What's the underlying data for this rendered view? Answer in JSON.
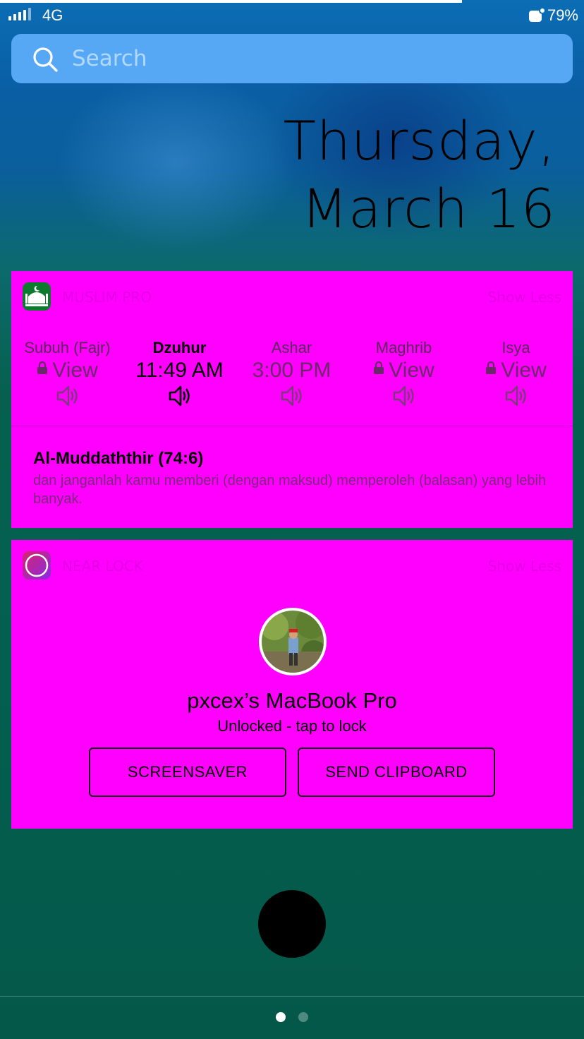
{
  "status_bar": {
    "carrier": "4G",
    "battery": "79%"
  },
  "search": {
    "placeholder": "Search"
  },
  "date": {
    "line1": "Thursday,",
    "line2": "March 16"
  },
  "muslim_pro_widget": {
    "app_name": "MUSLIM PRO",
    "show_more": "Show Less",
    "prayers": [
      {
        "name": "Subuh (Fajr)",
        "time": "View",
        "locked": true,
        "active": false
      },
      {
        "name": "Dzuhur",
        "time": "11:49 AM",
        "locked": false,
        "active": true
      },
      {
        "name": "Ashar",
        "time": "3:00 PM",
        "locked": false,
        "active": false
      },
      {
        "name": "Maghrib",
        "time": "View",
        "locked": true,
        "active": false
      },
      {
        "name": "Isya",
        "time": "View",
        "locked": true,
        "active": false
      }
    ],
    "verse_title": "Al-Muddaththir (74:6)",
    "verse_text": "dan janganlah kamu memberi (dengan maksud) memperoleh (balasan) yang lebih banyak."
  },
  "mac_widget": {
    "app_name": "NEAR LOCK",
    "show_more": "Show Less",
    "device_name": "pxcex’s MacBook Pro",
    "device_status": "Unlocked - tap to lock",
    "buttons": {
      "screensaver": "SCREENSAVER",
      "send_clipboard": "SEND CLIPBOARD"
    }
  },
  "page_indicator": {
    "pages": 2,
    "current": 1
  },
  "colors": {
    "widget_bg": "#ff00ff",
    "search_bg": "#56a8f5"
  }
}
